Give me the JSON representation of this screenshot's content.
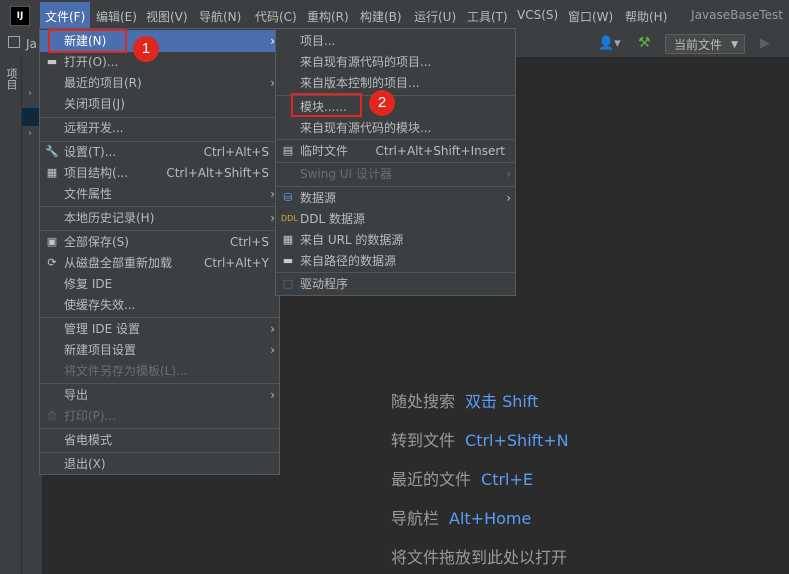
{
  "menubar": {
    "logo": "IJ",
    "items": [
      "文件(F)",
      "编辑(E)",
      "视图(V)",
      "导航(N)",
      "代码(C)",
      "重构(R)",
      "构建(B)",
      "运行(U)",
      "工具(T)",
      "VCS(S)",
      "窗口(W)",
      "帮助(H)"
    ],
    "project_title": "JavaseBaseTest"
  },
  "toolbar": {
    "tab_partial": "Ja",
    "run_config": "当前文件"
  },
  "sidebar": {
    "project_tab": "项目"
  },
  "file_menu": {
    "items": [
      {
        "label": "新建(N)",
        "shortcut": "",
        "submenu": true
      },
      {
        "label": "打开(O)...",
        "shortcut": ""
      },
      {
        "label": "最近的项目(R)",
        "shortcut": "",
        "submenu": true
      },
      {
        "label": "关闭项目(J)",
        "shortcut": ""
      },
      {
        "label": "远程开发...",
        "shortcut": ""
      },
      {
        "label": "设置(T)...",
        "shortcut": "Ctrl+Alt+S"
      },
      {
        "label": "项目结构(...",
        "shortcut": "Ctrl+Alt+Shift+S"
      },
      {
        "label": "文件属性",
        "shortcut": "",
        "submenu": true
      },
      {
        "label": "本地历史记录(H)",
        "shortcut": "",
        "submenu": true
      },
      {
        "label": "全部保存(S)",
        "shortcut": "Ctrl+S"
      },
      {
        "label": "从磁盘全部重新加载",
        "shortcut": "Ctrl+Alt+Y"
      },
      {
        "label": "修复 IDE",
        "shortcut": ""
      },
      {
        "label": "使缓存失效...",
        "shortcut": ""
      },
      {
        "label": "管理 IDE 设置",
        "shortcut": "",
        "submenu": true
      },
      {
        "label": "新建项目设置",
        "shortcut": "",
        "submenu": true
      },
      {
        "label": "将文件另存为模板(L)...",
        "shortcut": "",
        "disabled": true
      },
      {
        "label": "导出",
        "shortcut": "",
        "submenu": true
      },
      {
        "label": "打印(P)...",
        "shortcut": "",
        "disabled": true
      },
      {
        "label": "省电模式",
        "shortcut": ""
      },
      {
        "label": "退出(X)",
        "shortcut": ""
      }
    ]
  },
  "new_menu": {
    "items": [
      {
        "label": "项目..."
      },
      {
        "label": "来自现有源代码的项目..."
      },
      {
        "label": "来自版本控制的项目..."
      },
      {
        "label": "模块......"
      },
      {
        "label": "来自现有源代码的模块..."
      },
      {
        "label": "临时文件",
        "shortcut": "Ctrl+Alt+Shift+Insert"
      },
      {
        "label": "Swing UI 设计器",
        "disabled": true
      },
      {
        "label": "数据源"
      },
      {
        "label": "DDL 数据源"
      },
      {
        "label": "来自 URL 的数据源"
      },
      {
        "label": "来自路径的数据源"
      },
      {
        "label": "驱动程序"
      }
    ]
  },
  "annotations": {
    "badge1": "1",
    "badge2": "2"
  },
  "editor_hints": [
    {
      "text": "随处搜索",
      "key": "双击 Shift"
    },
    {
      "text": "转到文件",
      "key": "Ctrl+Shift+N"
    },
    {
      "text": "最近的文件",
      "key": "Ctrl+E"
    },
    {
      "text": "导航栏",
      "key": "Alt+Home"
    },
    {
      "text": "将文件拖放到此处以打开",
      "key": ""
    }
  ],
  "colors": {
    "accent": "#4b6eaf",
    "annotation_red": "#e0271e",
    "key_blue": "#589df6"
  }
}
